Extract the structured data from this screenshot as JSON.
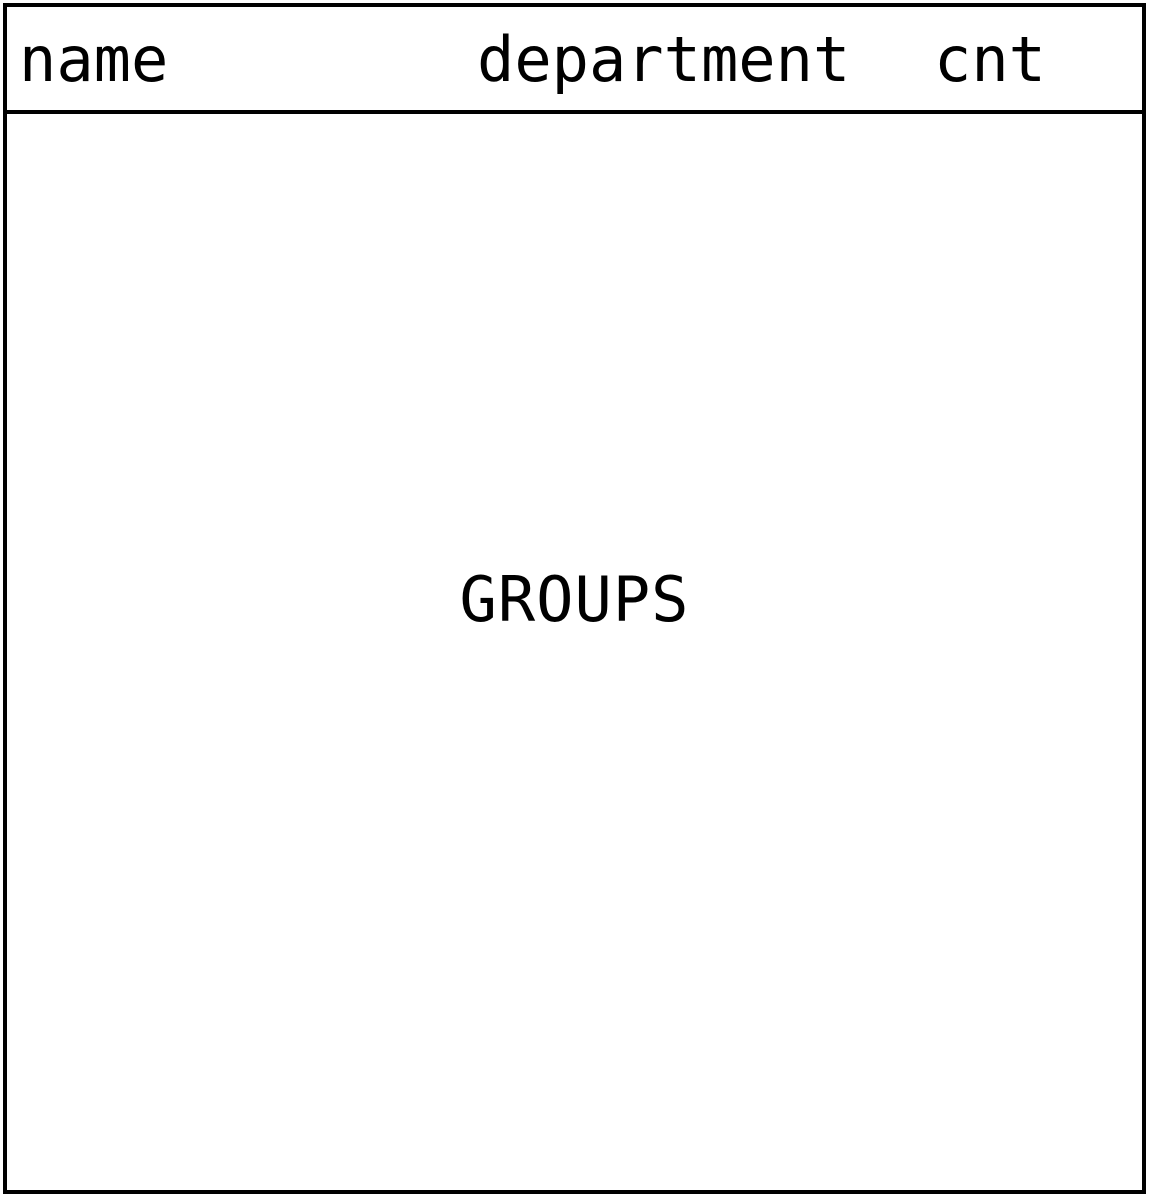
{
  "table": {
    "columns": [
      "name",
      "department",
      "cnt"
    ],
    "label": "GROUPS"
  }
}
